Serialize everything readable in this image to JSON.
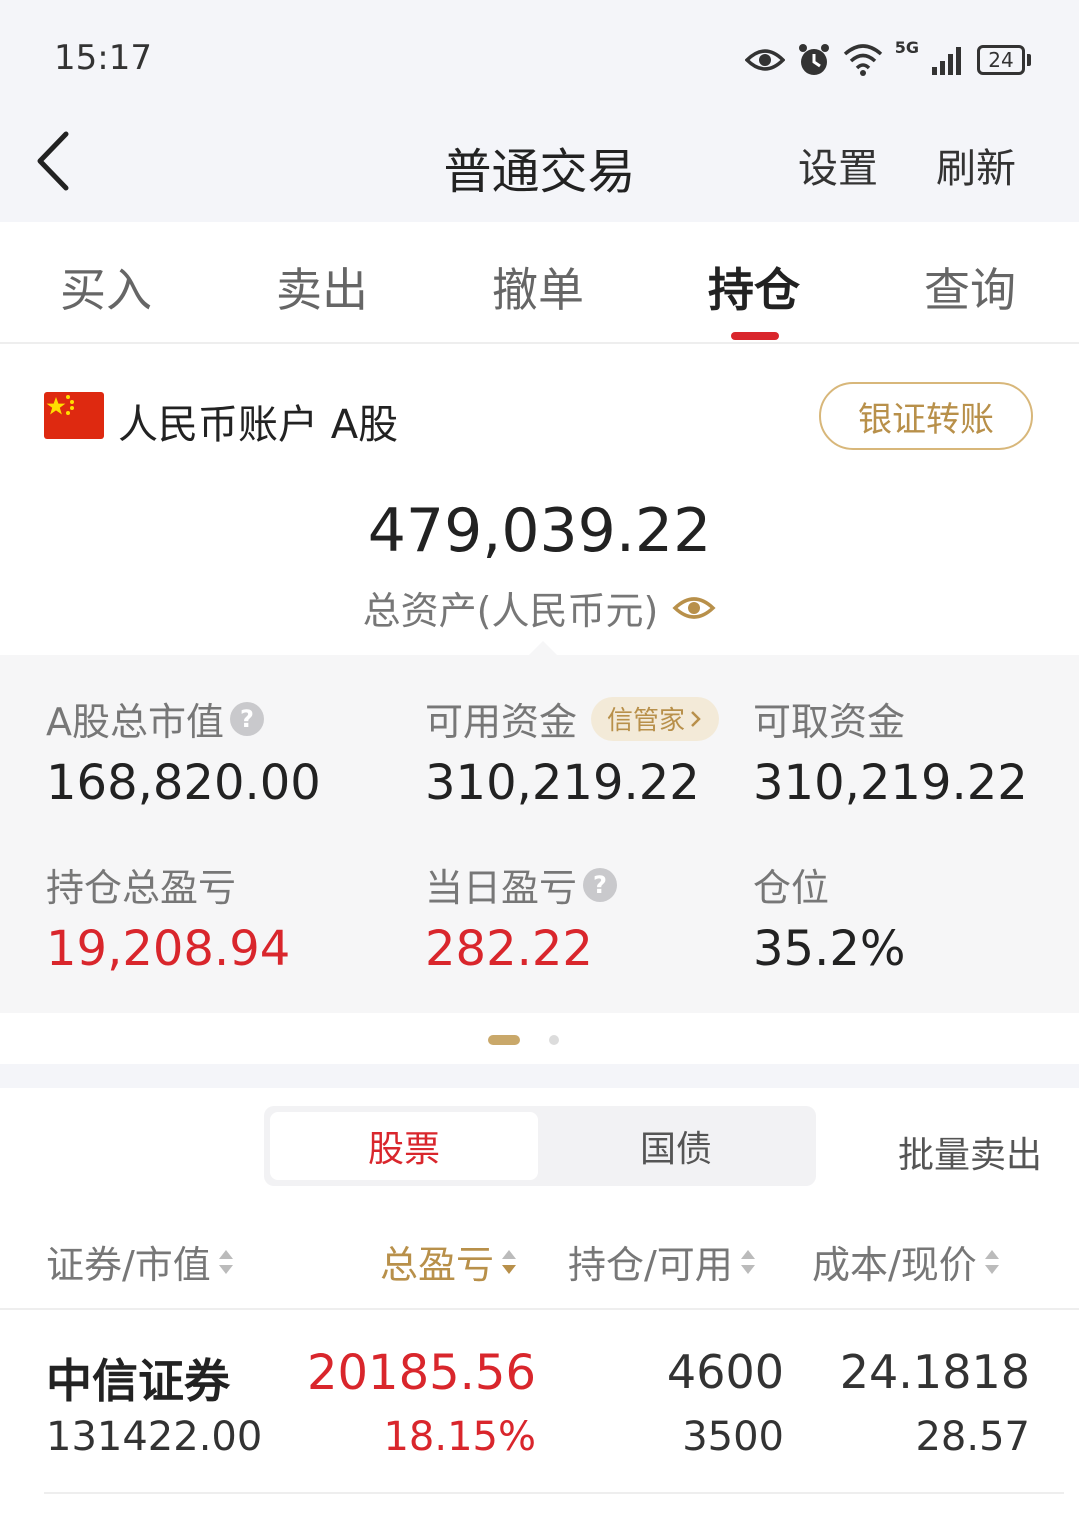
{
  "status_bar": {
    "time": "15:17",
    "network": "5G",
    "battery": "24"
  },
  "nav": {
    "title": "普通交易",
    "settings_label": "设置",
    "refresh_label": "刷新"
  },
  "tabs": [
    {
      "label": "买入",
      "active": false
    },
    {
      "label": "卖出",
      "active": false
    },
    {
      "label": "撤单",
      "active": false
    },
    {
      "label": "持仓",
      "active": true
    },
    {
      "label": "查询",
      "active": false
    }
  ],
  "account": {
    "label": "人民币账户 A股",
    "transfer_label": "银证转账"
  },
  "summary": {
    "total_assets": "479,039.22",
    "total_assets_label": "总资产(人民币元)"
  },
  "stats": {
    "a_share_mv_label": "A股总市值",
    "a_share_mv": "168,820.00",
    "available_funds_label": "可用资金",
    "xinguanjia_label": "信管家",
    "available_funds": "310,219.22",
    "withdrawable_label": "可取资金",
    "withdrawable": "310,219.22",
    "holding_pl_label": "持仓总盈亏",
    "holding_pl": "19,208.94",
    "daily_pl_label": "当日盈亏",
    "daily_pl": "282.22",
    "position_label": "仓位",
    "position": "35.2%"
  },
  "segments": [
    {
      "label": "股票",
      "active": true
    },
    {
      "label": "国债",
      "active": false
    }
  ],
  "batch_sell_label": "批量卖出",
  "columns": {
    "security": "证券/市值",
    "total_pl": "总盈亏",
    "holding": "持仓/可用",
    "cost": "成本/现价"
  },
  "holdings": [
    {
      "name": "中信证券",
      "market_value": "131422.00",
      "pl_amount": "20185.56",
      "pl_percent": "18.15%",
      "quantity": "4600",
      "available": "3500",
      "cost": "24.1818",
      "price": "28.57"
    }
  ],
  "colors": {
    "accent_red": "#d9262c",
    "gold": "#b8904a",
    "panel_bg": "#f6f6f7"
  }
}
